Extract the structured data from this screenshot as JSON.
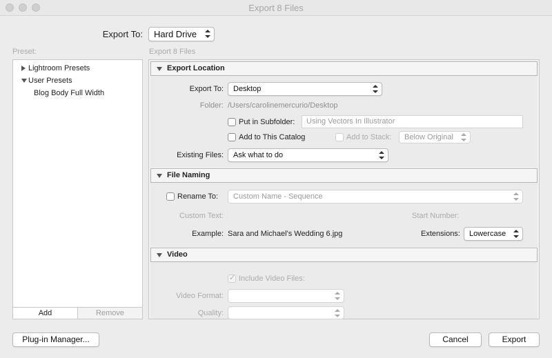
{
  "window": {
    "title": "Export 8 Files"
  },
  "export_to": {
    "label": "Export To:",
    "value": "Hard Drive"
  },
  "preset": {
    "label": "Preset:",
    "tree": [
      {
        "label": "Lightroom Presets"
      },
      {
        "label": "User Presets",
        "children": [
          "Blog Body Full Width"
        ]
      }
    ],
    "add_label": "Add",
    "remove_label": "Remove"
  },
  "main": {
    "caption": "Export 8 Files",
    "export_location": {
      "title": "Export Location",
      "export_to_label": "Export To:",
      "export_to_value": "Desktop",
      "folder_label": "Folder:",
      "folder_value": "/Users/carolinemercurio/Desktop",
      "subfolder_label": "Put in Subfolder:",
      "subfolder_value": "Using Vectors In Illustrator",
      "add_catalog_label": "Add to This Catalog",
      "add_stack_label": "Add to Stack:",
      "stack_value": "Below Original",
      "existing_files_label": "Existing Files:",
      "existing_files_value": "Ask what to do"
    },
    "file_naming": {
      "title": "File Naming",
      "rename_label": "Rename To:",
      "rename_value": "Custom Name - Sequence",
      "custom_text_label": "Custom Text:",
      "start_number_label": "Start Number:",
      "example_label": "Example:",
      "example_value": "Sara and Michael's Wedding 6.jpg",
      "extensions_label": "Extensions:",
      "extensions_value": "Lowercase"
    },
    "video": {
      "title": "Video",
      "include_label": "Include Video Files:",
      "format_label": "Video Format:",
      "quality_label": "Quality:"
    }
  },
  "footer": {
    "plugin_manager_label": "Plug-in Manager...",
    "cancel_label": "Cancel",
    "export_label": "Export"
  }
}
